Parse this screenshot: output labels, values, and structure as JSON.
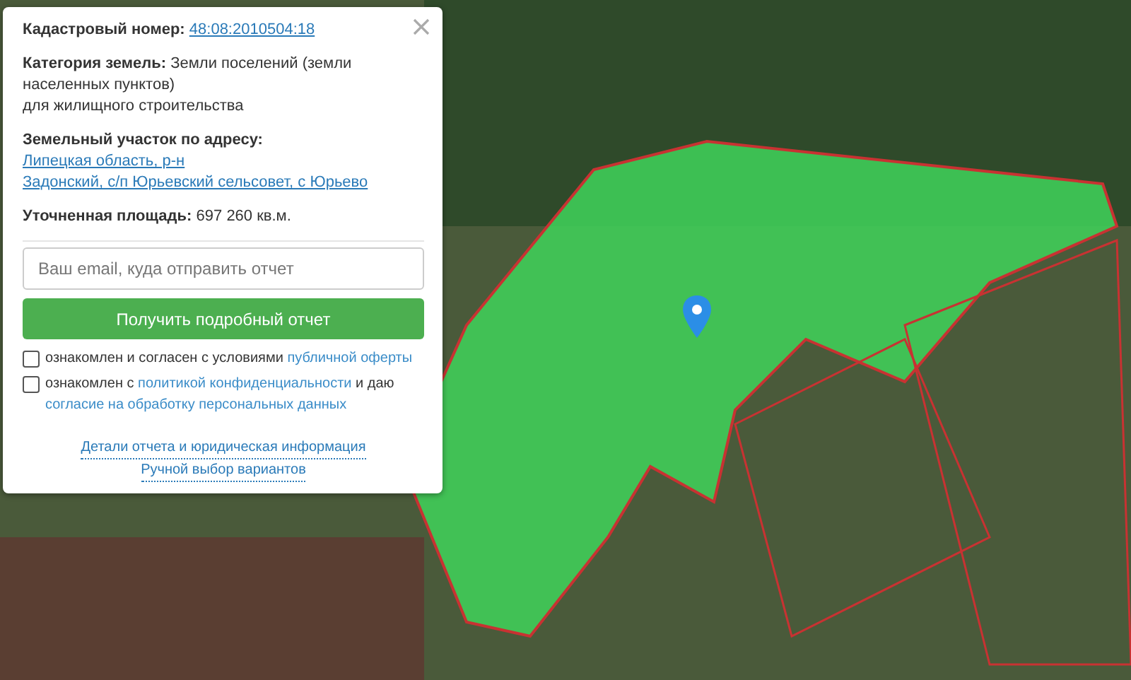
{
  "info": [
    {
      "label": "Кадастровый номер:",
      "kind": "link",
      "lines": [
        "48:08:2010504:18"
      ]
    },
    {
      "label": "Категория земель:",
      "kind": "text",
      "lines": [
        "Земли поселений (земли населенных пунктов)",
        "для жилищного строительства"
      ]
    },
    {
      "label": "Земельный участок по адресу:",
      "kind": "link",
      "lines": [
        "Липецкая область, р-н",
        "Задонский, с/п Юрьевский сельсовет, с Юрьево"
      ]
    },
    {
      "label": "Уточненная площадь:",
      "kind": "text",
      "lines": [
        "697 260 кв.м."
      ]
    }
  ],
  "email": {
    "placeholder": "Ваш email, куда отправить отчет"
  },
  "submit": "Получить подробный отчет",
  "consents": [
    {
      "checked": false,
      "parts": [
        {
          "kind": "text",
          "text": "ознакомлен и согласен с условиями "
        },
        {
          "kind": "link",
          "text": "публичной оферты"
        }
      ]
    },
    {
      "checked": false,
      "parts": [
        {
          "kind": "text",
          "text": "ознакомлен с "
        },
        {
          "kind": "link",
          "text": "политикой конфиденциальности"
        },
        {
          "kind": "text",
          "text": " и даю "
        },
        {
          "kind": "link",
          "text": "согласие на обработку персональных данных"
        }
      ]
    }
  ],
  "footer_links": [
    "Детали отчета и юридическая информация",
    "Ручной выбор вариантов"
  ]
}
